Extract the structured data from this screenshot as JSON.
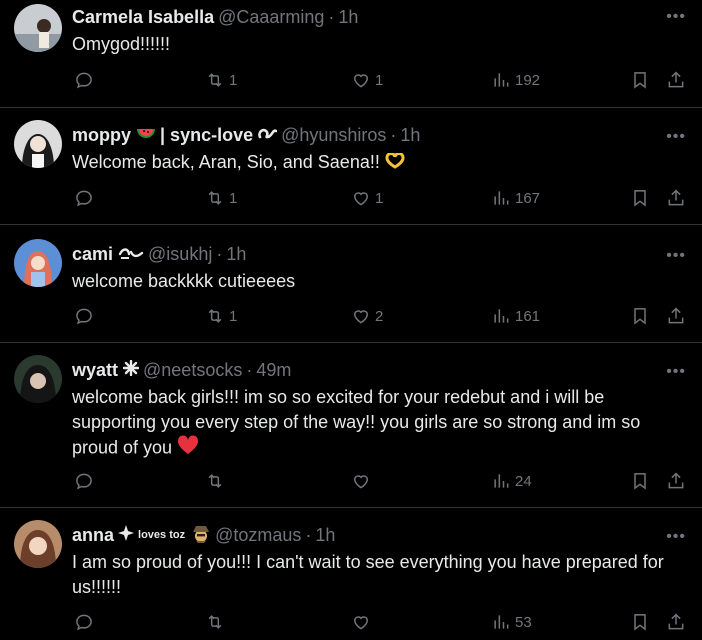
{
  "tweets": [
    {
      "name": "Carmela Isabella",
      "handle": "@Caaarming",
      "time": "1h",
      "text": "Omygod!!!!!!",
      "replies": "",
      "retweets": "1",
      "likes": "1",
      "views": "192"
    },
    {
      "name": "moppy",
      "name_extra": "| sync-love",
      "handle": "@hyunshiros",
      "time": "1h",
      "text": "Welcome back, Aran, Sio, and Saena!!",
      "replies": "",
      "retweets": "1",
      "likes": "1",
      "views": "167"
    },
    {
      "name": "cami",
      "handle": "@isukhj",
      "time": "1h",
      "text": "welcome backkkk cutieeees",
      "replies": "",
      "retweets": "1",
      "likes": "2",
      "views": "161"
    },
    {
      "name": "wyatt",
      "handle": "@neetsocks",
      "time": "49m",
      "text": "welcome back girls!!! im so so excited for your redebut and i will be supporting you every step of the way!! you girls are so strong and im so proud of you",
      "replies": "",
      "retweets": "",
      "likes": "",
      "views": "24"
    },
    {
      "name": "anna",
      "name_extra": "loves toz",
      "handle": "@tozmaus",
      "time": "1h",
      "text": "I am so proud of you!!! I can't wait to see everything you have prepared for us!!!!!!",
      "replies": "",
      "retweets": "",
      "likes": "",
      "views": "53"
    }
  ],
  "ui": {
    "dot": "·",
    "more": "•••"
  },
  "colors": {
    "background": "#000000",
    "text": "#e7e9ea",
    "muted": "#71767b",
    "divider": "#2f3336",
    "heart": "#f91880"
  },
  "icons": [
    "reply-icon",
    "retweet-icon",
    "like-icon",
    "views-icon",
    "bookmark-icon",
    "share-icon",
    "more-icon"
  ]
}
